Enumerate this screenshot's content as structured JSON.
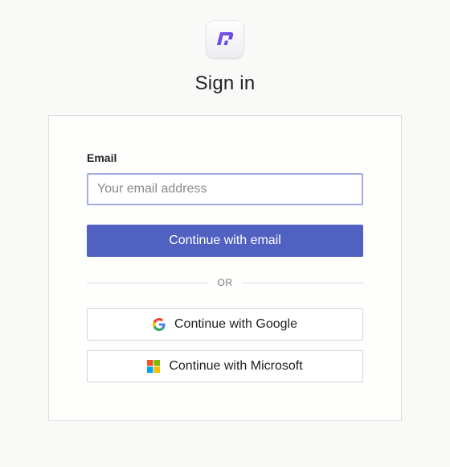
{
  "page": {
    "title": "Sign in"
  },
  "logo": {
    "icon": "app-logo-icon",
    "color": "#6a4be0"
  },
  "form": {
    "email_label": "Email",
    "email_value": "",
    "email_placeholder": "Your email address",
    "submit_label": "Continue with email",
    "divider_text": "OR",
    "google_label": "Continue with Google",
    "google_icon": "google-icon",
    "microsoft_label": "Continue with Microsoft",
    "microsoft_icon": "microsoft-icon"
  },
  "colors": {
    "primary": "#5161c2",
    "input_focus_border": "#a6acdf",
    "background": "#f9f9f7"
  }
}
